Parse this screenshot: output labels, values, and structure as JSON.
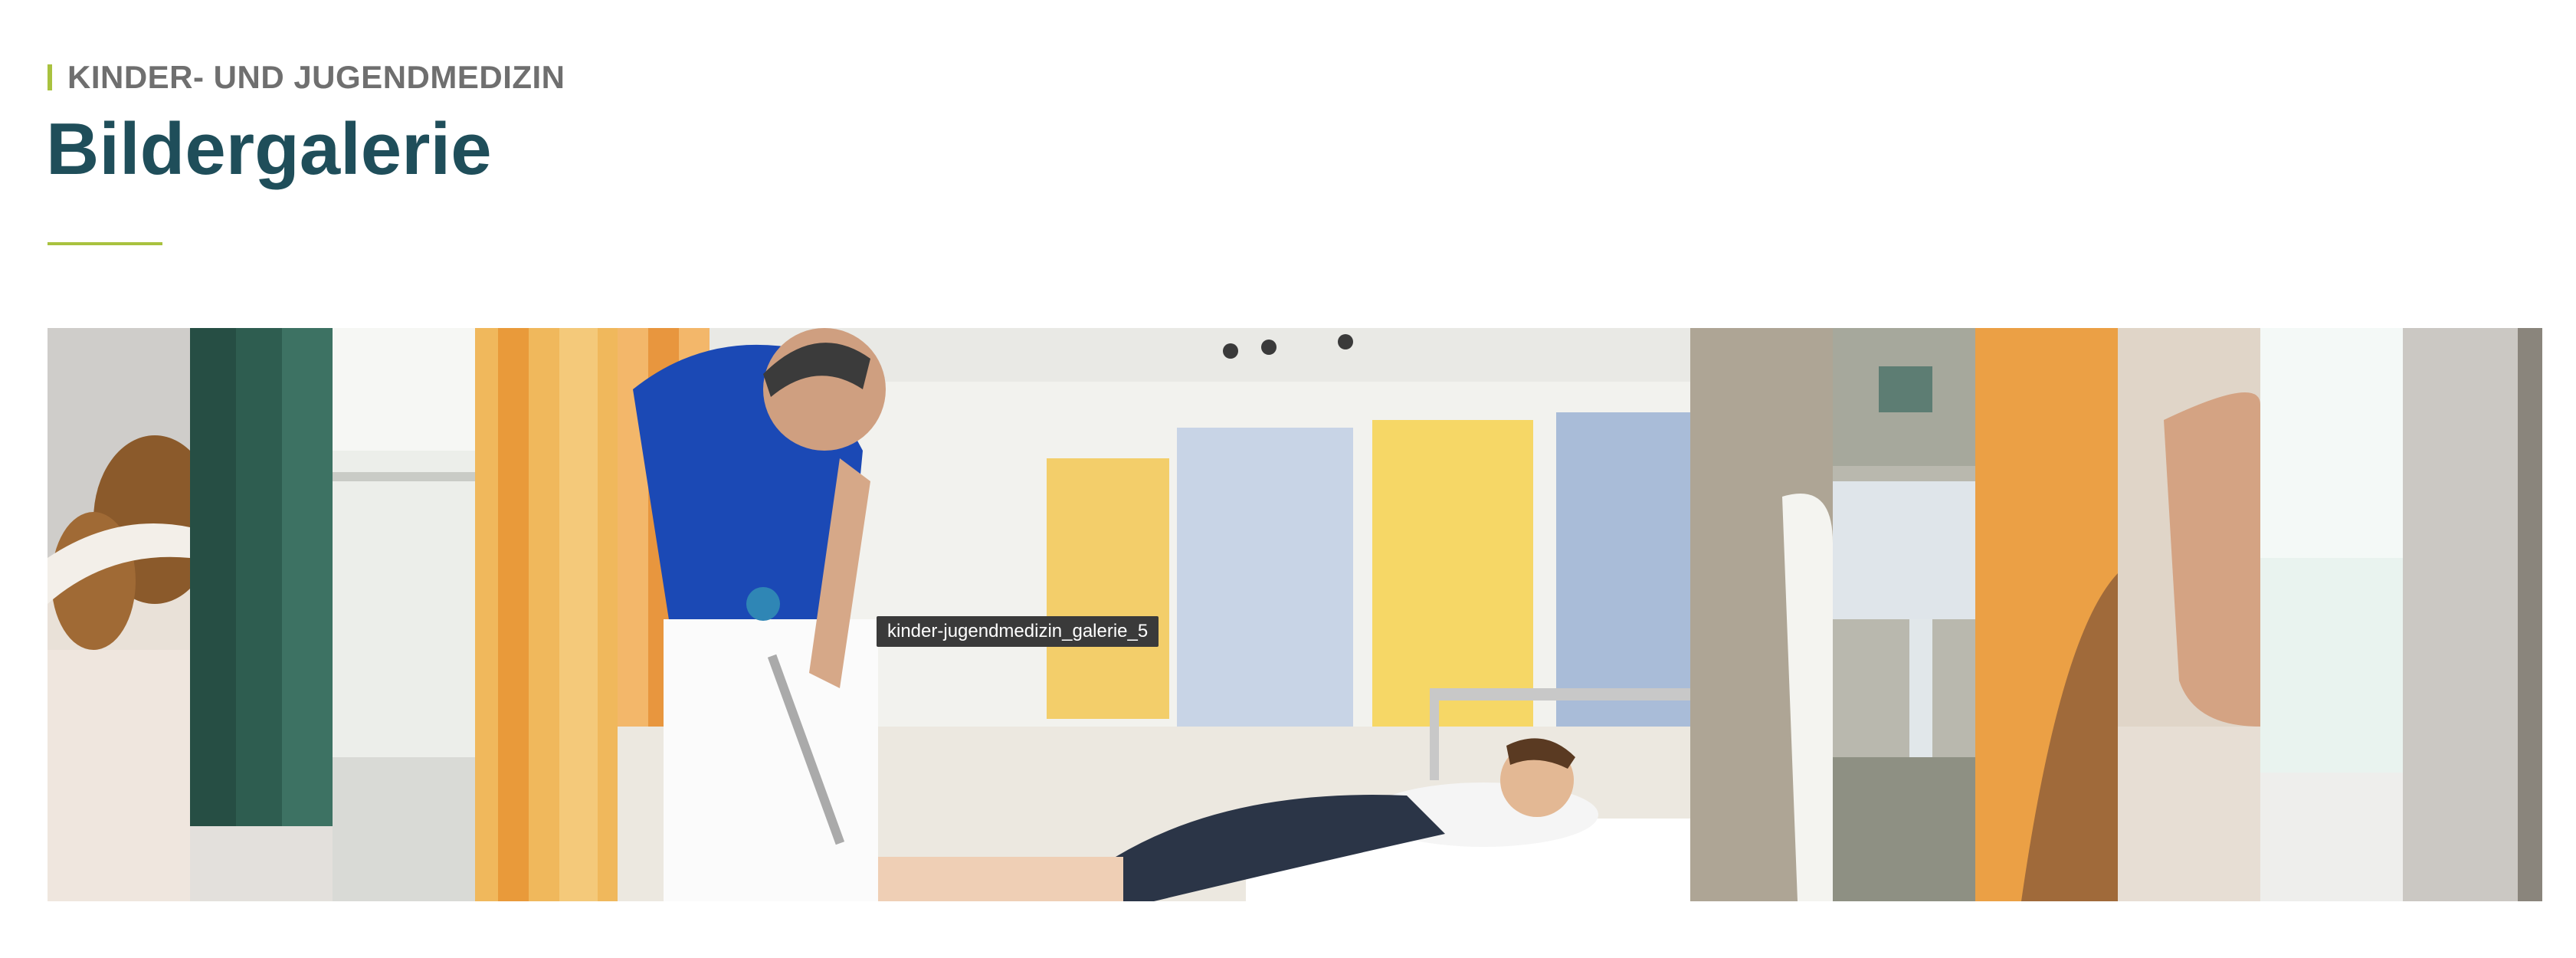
{
  "header": {
    "eyebrow": "KINDER- UND JUGENDMEDIZIN",
    "title": "Bildergalerie"
  },
  "colors": {
    "accent": "#a9c23f",
    "title": "#1f4e5a",
    "eyebrow": "#6f6f6f"
  },
  "gallery": {
    "active_index": 4,
    "tooltip": "kinder-jugendmedizin_galerie_5",
    "items_count": 12
  }
}
